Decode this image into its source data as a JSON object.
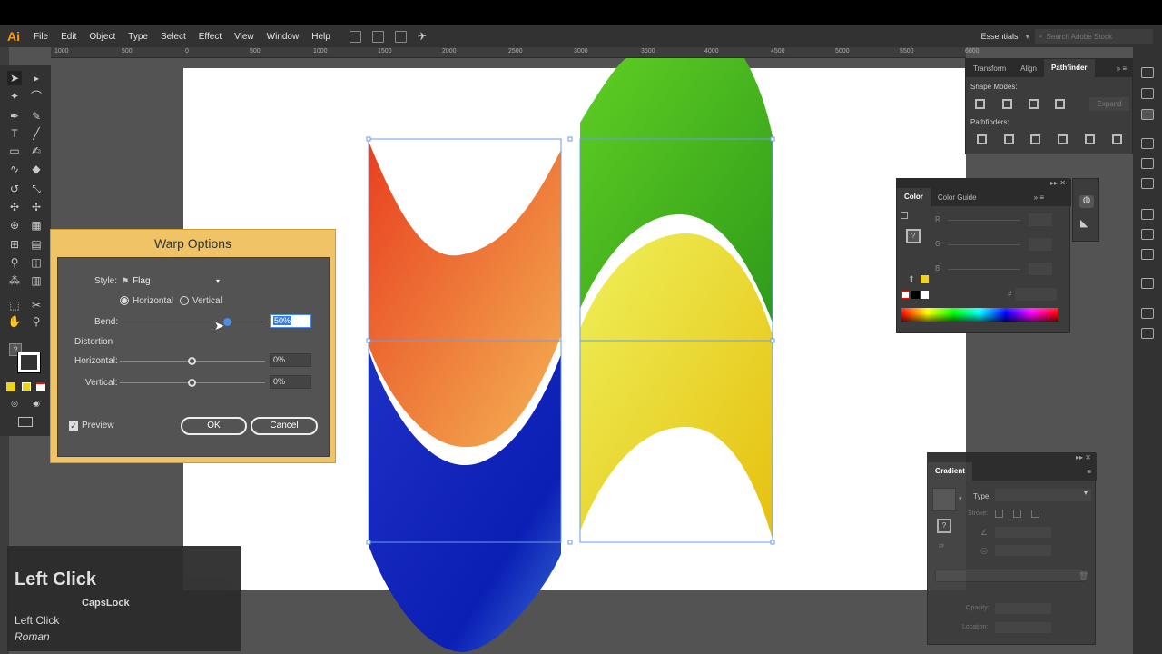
{
  "app": {
    "logo": "Ai",
    "menus": [
      "File",
      "Edit",
      "Object",
      "Type",
      "Select",
      "Effect",
      "View",
      "Window",
      "Help"
    ],
    "workspace": "Essentials",
    "search_placeholder": "Search Adobe Stock"
  },
  "ruler": {
    "ticks": [
      "1000",
      "500",
      "0",
      "500",
      "1000",
      "1500",
      "2000",
      "2500",
      "3000",
      "3500",
      "4000",
      "4500",
      "5000",
      "5500",
      "6000"
    ]
  },
  "pathfinder_panel": {
    "tabs": [
      "Transform",
      "Align",
      "Pathfinder"
    ],
    "shape_modes_label": "Shape Modes:",
    "pathfinders_label": "Pathfinders:",
    "expand_label": "Expand"
  },
  "color_panel": {
    "tabs": [
      "Color",
      "Color Guide"
    ],
    "channels": [
      "R",
      "G",
      "B"
    ],
    "hex_label": "#"
  },
  "gradient_panel": {
    "title": "Gradient",
    "type_label": "Type:",
    "stroke_label": "Stroke:",
    "opacity_label": "Opacity:",
    "location_label": "Location:"
  },
  "warp_dialog": {
    "title": "Warp Options",
    "style_label": "Style:",
    "style_value": "Flag",
    "orientation_horizontal": "Horizontal",
    "orientation_vertical": "Vertical",
    "orientation_selected": "Horizontal",
    "bend_label": "Bend:",
    "bend_value": "50%",
    "bend_fraction": 0.75,
    "distortion_label": "Distortion",
    "horizontal_label": "Horizontal:",
    "horizontal_value": "0%",
    "vertical_label": "Vertical:",
    "vertical_value": "0%",
    "preview_label": "Preview",
    "preview_checked": true,
    "ok_label": "OK",
    "cancel_label": "Cancel"
  },
  "keystroke_overlay": {
    "action": "Left Click",
    "key": "CapsLock",
    "line1": "Left Click",
    "line2": "Roman"
  },
  "colors": {
    "accent": "#ff9a00",
    "dialog_frame": "#f0c466",
    "red_orange": "#ec5a25",
    "green": "#3fad1b",
    "blue": "#0e2ac0",
    "yellow": "#e7e544"
  }
}
